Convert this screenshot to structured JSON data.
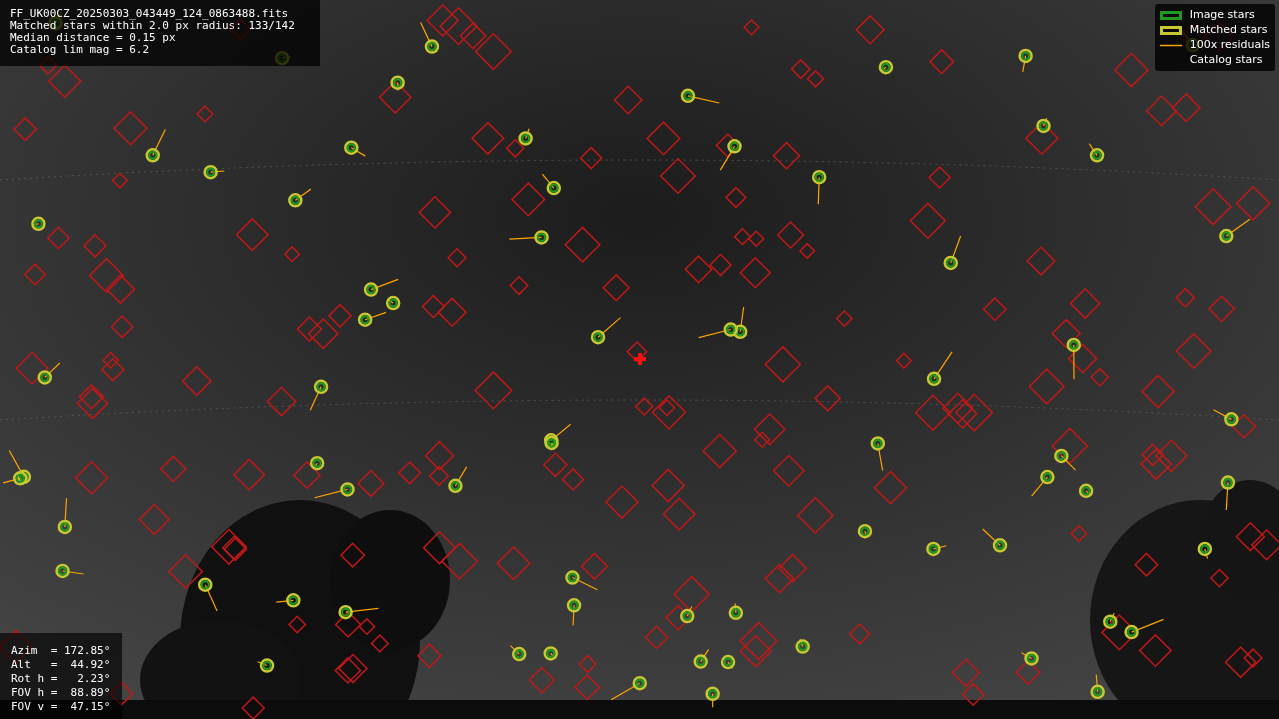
{
  "info_box": {
    "lines": [
      "FF_UK00CZ_20250303_043449_124_0863488.fits",
      "Matched stars within 2.0 px radius: 133/142",
      "Median distance = 0.15 px",
      "Catalog lim mag = 6.2"
    ]
  },
  "legend": [
    {
      "label": "Image stars"
    },
    {
      "kind": "matched",
      "label": "Matched stars"
    },
    {
      "kind": "residual",
      "label": "100x residuals"
    },
    {
      "kind": "catalog",
      "label": "Catalog stars"
    }
  ],
  "pointing": {
    "lines": [
      "Azim  = 172.85°",
      "Alt   =  44.92°",
      "Rot h =   2.23°",
      "FOV h =  88.89°",
      "FOV v =  47.15°"
    ]
  }
}
